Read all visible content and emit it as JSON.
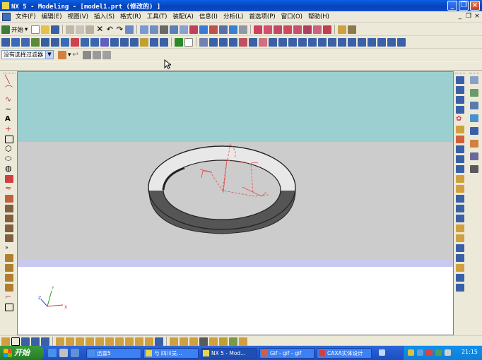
{
  "window": {
    "title": "NX 5 - Modeling - [model1.prt  (修改的) ]"
  },
  "menubar": {
    "items": [
      "文件(F)",
      "编辑(E)",
      "视图(V)",
      "插入(S)",
      "格式(R)",
      "工具(T)",
      "装配(A)",
      "信息(I)",
      "分析(L)",
      "首选项(P)",
      "窗口(O)",
      "帮助(H)"
    ]
  },
  "toolbar_standard": {
    "start_label": "开始"
  },
  "selection_bar": {
    "filter_value": "没有选择过滤器"
  },
  "view_triad": {
    "x_label": "X",
    "y_label": "Y",
    "z_label": "Z"
  },
  "taskbar": {
    "start_label": "开始",
    "tasks": [
      "迅雷5",
      "与 四川吴...",
      "NX 5 - Mod...",
      "Gif - gif - gif",
      "CAXA实体设计"
    ],
    "clock": "21:15"
  },
  "colors": {
    "title_bar": "#0842b8",
    "viewport_top": "#9ccfcf",
    "viewport_mid": "#cccccc",
    "viewport_band": "#c8c8f0",
    "sketch_color": "#e05050"
  }
}
